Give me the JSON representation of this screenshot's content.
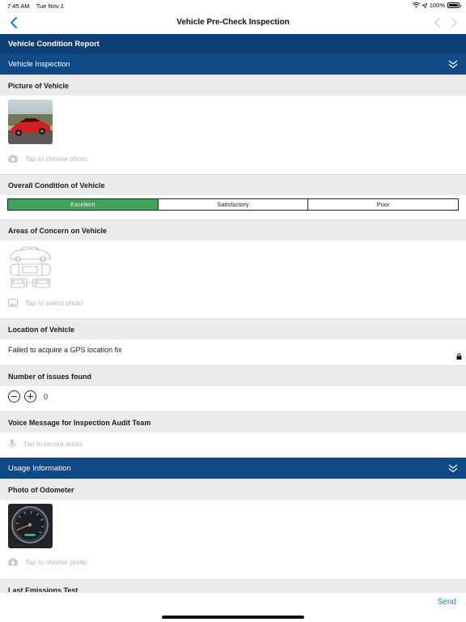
{
  "status": {
    "time": "7:45 AM",
    "date": "Tue Nov 1",
    "battery": "100%"
  },
  "nav": {
    "title": "Vehicle Pre-Check Inspection"
  },
  "report": {
    "title": "Vehicle Condition Report"
  },
  "sections": {
    "inspection": "Vehicle Inspection",
    "usage": "Usage Information"
  },
  "fields": {
    "picture": {
      "label": "Picture of Vehicle",
      "hint": "Tap to choose photo"
    },
    "condition": {
      "label": "Overall Condition of Vehicle",
      "options": [
        "Excellent",
        "Satisfactory",
        "Poor"
      ],
      "selected": "Excellent"
    },
    "areas": {
      "label": "Areas of Concern on Vehicle",
      "hint": "Tap to select photo"
    },
    "location": {
      "label": "Location of Vehicle",
      "value": "Failed to acquire a GPS location fix"
    },
    "issues": {
      "label": "Number of issues found",
      "value": "0"
    },
    "voice": {
      "label": "Voice Message for Inspection Audit Team",
      "hint": "Tap to record audio"
    },
    "odometer": {
      "label": "Photo of Odometer",
      "hint": "Tap to choose photo"
    },
    "emissions": {
      "label": "Last Emissions Test"
    }
  },
  "footer": {
    "send": "Send"
  },
  "colors": {
    "header": "#0d3f74",
    "section": "#0f4a86",
    "accent": "#1a7de0",
    "selected": "#43a35b"
  }
}
